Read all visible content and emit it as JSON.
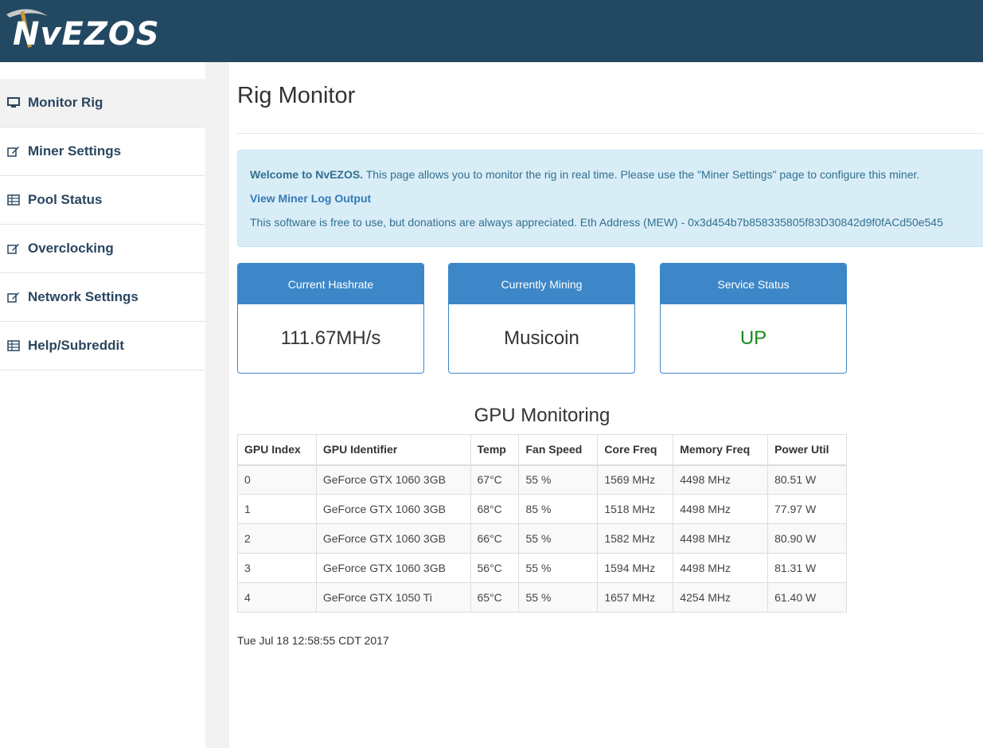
{
  "brand": {
    "name": "NvEZOS",
    "color": "#234862"
  },
  "sidebar": {
    "items": [
      {
        "label": "Monitor Rig",
        "icon": "monitor-icon",
        "active": true
      },
      {
        "label": "Miner Settings",
        "icon": "edit-icon",
        "active": false
      },
      {
        "label": "Pool Status",
        "icon": "table-icon",
        "active": false
      },
      {
        "label": "Overclocking",
        "icon": "edit-icon",
        "active": false
      },
      {
        "label": "Network Settings",
        "icon": "edit-icon",
        "active": false
      },
      {
        "label": "Help/Subreddit",
        "icon": "table-icon",
        "active": false
      }
    ]
  },
  "page": {
    "title": "Rig Monitor"
  },
  "alert": {
    "welcome_bold": "Welcome to NvEZOS.",
    "welcome_text": " This page allows you to monitor the rig in real time. Please use the \"Miner Settings\" page to configure this miner.",
    "log_link": "View Miner Log Output",
    "donation_text": "This software is free to use, but donations are always appreciated. Eth Address (MEW) - 0x3d454b7b858335805f83D30842d9f0fACd50e545"
  },
  "stats": {
    "hashrate": {
      "label": "Current Hashrate",
      "value": "111.67MH/s"
    },
    "mining": {
      "label": "Currently Mining",
      "value": "Musicoin"
    },
    "service": {
      "label": "Service Status",
      "value": "UP",
      "color": "#1a8a1a"
    }
  },
  "gpu": {
    "title": "GPU Monitoring",
    "headers": [
      "GPU Index",
      "GPU Identifier",
      "Temp",
      "Fan Speed",
      "Core Freq",
      "Memory Freq",
      "Power Util"
    ],
    "rows": [
      [
        "0",
        "GeForce GTX 1060 3GB",
        "67°C",
        "55 %",
        "1569 MHz",
        "4498 MHz",
        "80.51 W"
      ],
      [
        "1",
        "GeForce GTX 1060 3GB",
        "68°C",
        "85 %",
        "1518 MHz",
        "4498 MHz",
        "77.97 W"
      ],
      [
        "2",
        "GeForce GTX 1060 3GB",
        "66°C",
        "55 %",
        "1582 MHz",
        "4498 MHz",
        "80.90 W"
      ],
      [
        "3",
        "GeForce GTX 1060 3GB",
        "56°C",
        "55 %",
        "1594 MHz",
        "4498 MHz",
        "81.31 W"
      ],
      [
        "4",
        "GeForce GTX 1050 Ti",
        "65°C",
        "55 %",
        "1657 MHz",
        "4254 MHz",
        "61.40 W"
      ]
    ]
  },
  "timestamp": "Tue Jul 18 12:58:55 CDT 2017"
}
